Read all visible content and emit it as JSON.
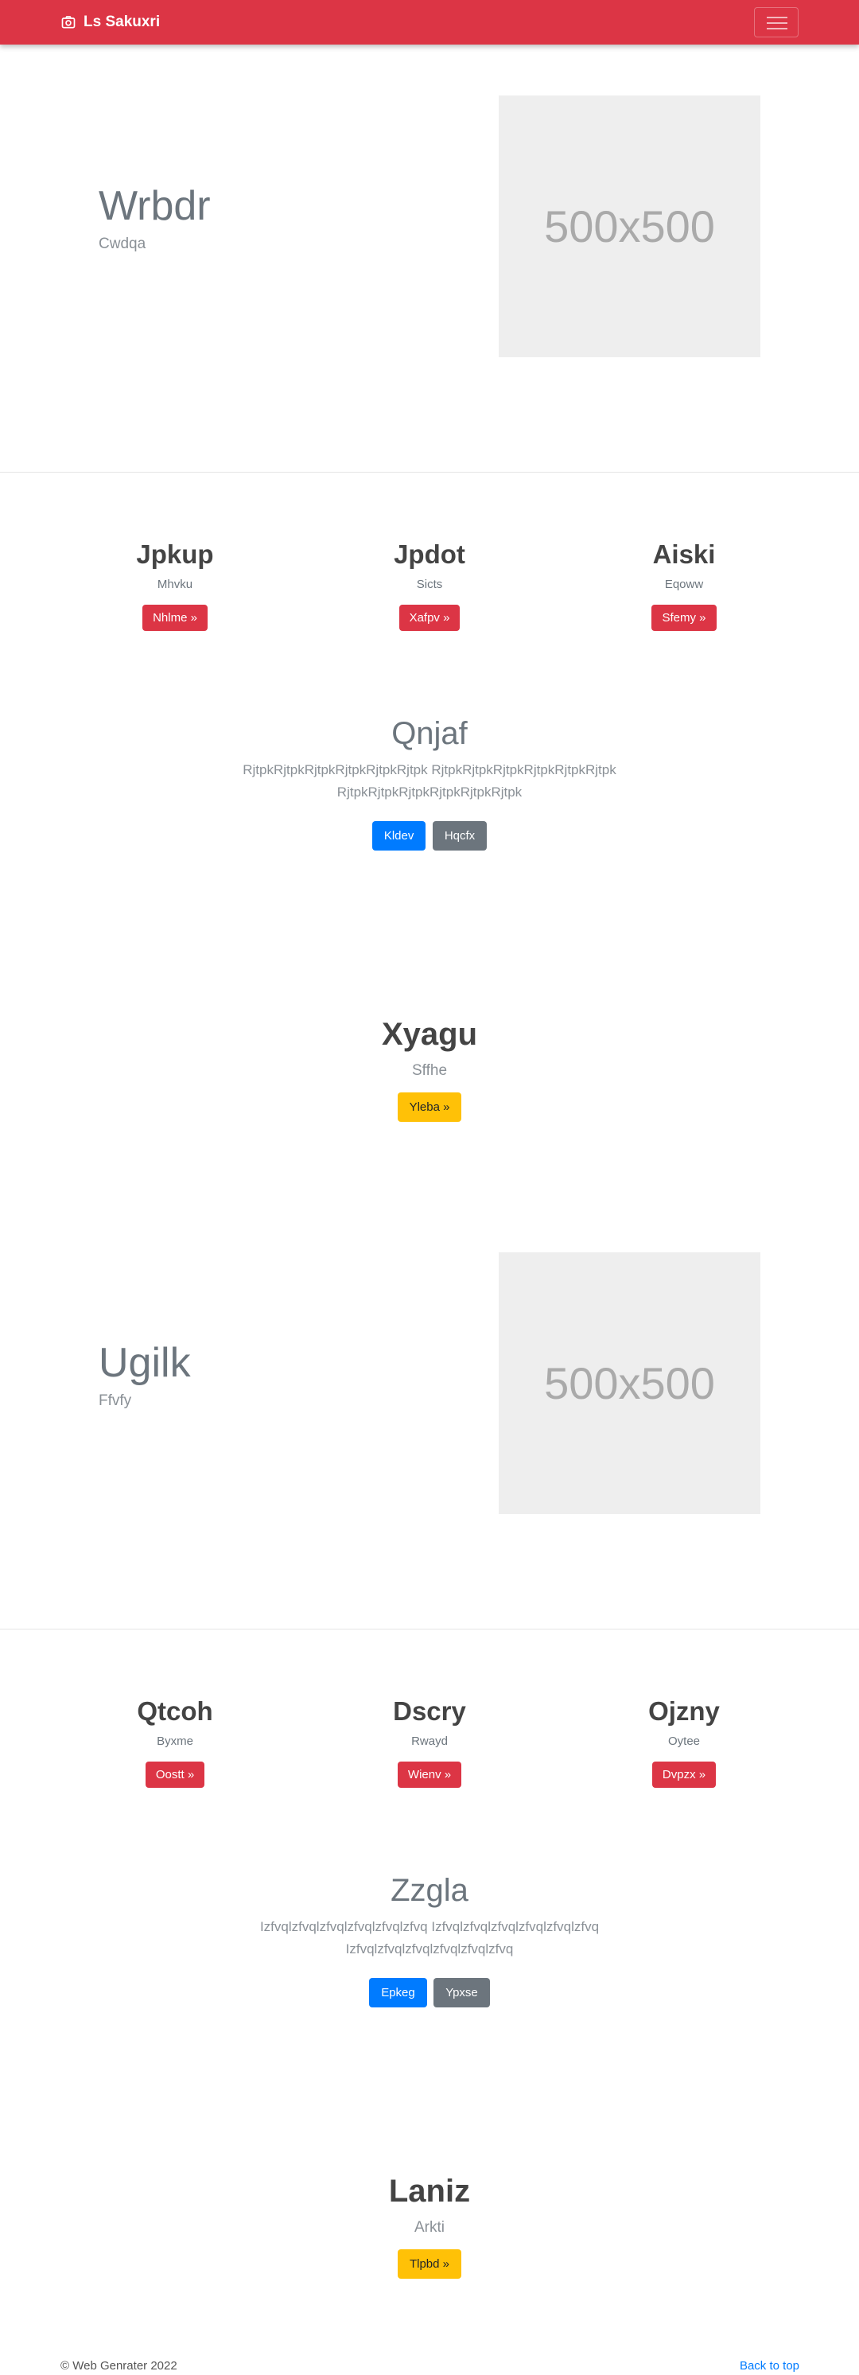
{
  "navbar": {
    "brand": "Ls Sakuxri",
    "brand_icon": "camera-icon",
    "toggler_icon": "hamburger-icon"
  },
  "hero1": {
    "title": "Wrbdr",
    "subtitle": "Cwdqa",
    "image_text": "500x500"
  },
  "cols1": [
    {
      "title": "Jpkup",
      "subtitle": "Mhvku",
      "button": "Nhlme »"
    },
    {
      "title": "Jpdot",
      "subtitle": "Sicts",
      "button": "Xafpv »"
    },
    {
      "title": "Aiski",
      "subtitle": "Eqoww",
      "button": "Sfemy »"
    }
  ],
  "lead1": {
    "title": "Qnjaf",
    "text": "RjtpkRjtpkRjtpkRjtpkRjtpkRjtpk RjtpkRjtpkRjtpkRjtpkRjtpkRjtpk RjtpkRjtpkRjtpkRjtpkRjtpkRjtpk",
    "primary": "Kldev",
    "secondary": "Hqcfx"
  },
  "feature1": {
    "title": "Xyagu",
    "subtitle": "Sffhe",
    "button": "Yleba »"
  },
  "hero2": {
    "title": "Ugilk",
    "subtitle": "Ffvfy",
    "image_text": "500x500"
  },
  "cols2": [
    {
      "title": "Qtcoh",
      "subtitle": "Byxme",
      "button": "Oostt »"
    },
    {
      "title": "Dscry",
      "subtitle": "Rwayd",
      "button": "Wienv »"
    },
    {
      "title": "Ojzny",
      "subtitle": "Oytee",
      "button": "Dvpzx »"
    }
  ],
  "lead2": {
    "title": "Zzgla",
    "text": "Izfvqlzfvqlzfvqlzfvqlzfvqlzfvq Izfvqlzfvqlzfvqlzfvqlzfvqlzfvq Izfvqlzfvqlzfvqlzfvqlzfvqlzfvq",
    "primary": "Epkeg",
    "secondary": "Ypxse"
  },
  "feature2": {
    "title": "Laniz",
    "subtitle": "Arkti",
    "button": "Tlpbd »"
  },
  "footer": {
    "copyright": "© Web Genrater 2022",
    "back_to_top": "Back to top"
  },
  "colors": {
    "primary_red": "#dc3545",
    "blue": "#007bff",
    "gray": "#6c757d",
    "yellow": "#ffc107"
  }
}
